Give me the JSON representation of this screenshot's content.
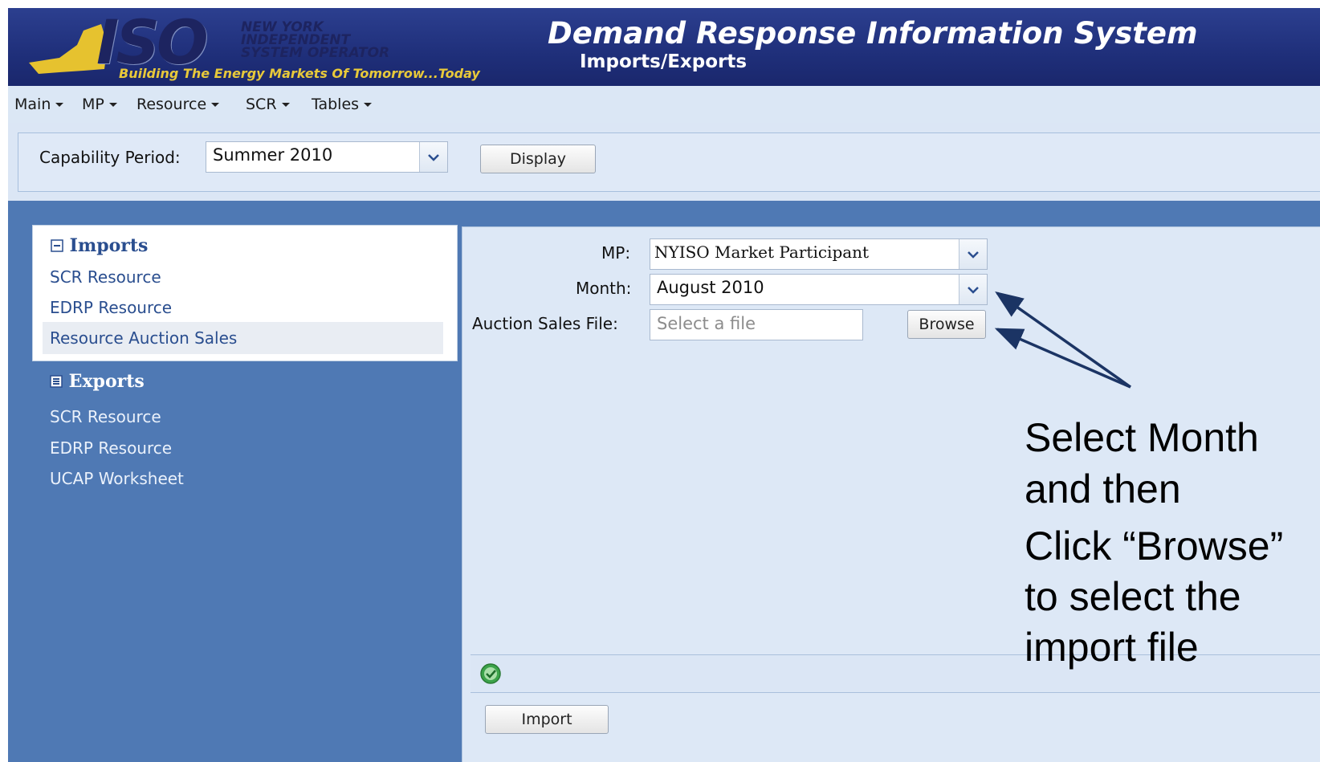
{
  "header": {
    "logo_iso": "ISO",
    "logo_org_lines": [
      "NEW YORK",
      "INDEPENDENT",
      "SYSTEM OPERATOR"
    ],
    "logo_tagline": "Building The Energy Markets Of Tomorrow...Today",
    "app_title": "Demand Response Information System",
    "page_title": "Imports/Exports"
  },
  "menu": {
    "items": [
      {
        "label": "Main"
      },
      {
        "label": "MP"
      },
      {
        "label": "Resource"
      },
      {
        "label": "SCR"
      },
      {
        "label": "Tables"
      }
    ]
  },
  "toolbar": {
    "capability_label": "Capability Period:",
    "capability_value": "Summer 2010",
    "display_label": "Display"
  },
  "nav": {
    "imports": {
      "title": "Imports",
      "items": [
        "SCR Resource",
        "EDRP Resource",
        "Resource Auction Sales"
      ]
    },
    "exports": {
      "title": "Exports",
      "items": [
        "SCR Resource",
        "EDRP Resource",
        "UCAP Worksheet"
      ]
    }
  },
  "form": {
    "mp_label": "MP:",
    "mp_value": "NYISO Market Participant",
    "month_label": "Month:",
    "month_value": "August 2010",
    "file_label": "Auction Sales File:",
    "file_placeholder": "Select a file",
    "browse_label": "Browse",
    "import_label": "Import"
  },
  "annotation": {
    "lines": [
      "Select Month",
      "and then",
      "Click “Browse”",
      "to select the",
      "import file"
    ]
  },
  "colors": {
    "header_bg": "#1f2f7a",
    "menu_bg": "#dbe7f5",
    "sidebar_bg": "#4f79b4",
    "content_bg": "#dde8f6",
    "link_color": "#2a4e8f",
    "tagline_color": "#e8c93a",
    "success": "#3ca34a",
    "arrow": "#1b3464"
  }
}
